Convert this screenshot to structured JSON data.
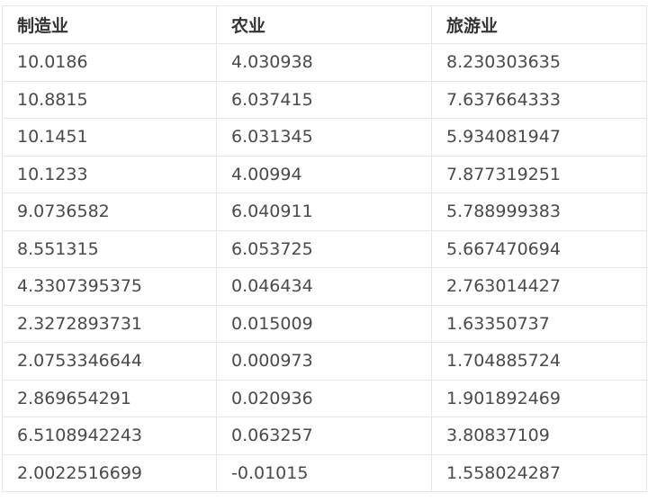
{
  "table": {
    "headers": [
      "制造业",
      "农业",
      "旅游业"
    ],
    "rows": [
      [
        "10.0186",
        "4.030938",
        "8.230303635"
      ],
      [
        "10.8815",
        "6.037415",
        "7.637664333"
      ],
      [
        "10.1451",
        "6.031345",
        "5.934081947"
      ],
      [
        "10.1233",
        "4.00994",
        "7.877319251"
      ],
      [
        "9.0736582",
        "6.040911",
        "5.788999383"
      ],
      [
        "8.551315",
        "6.053725",
        "5.667470694"
      ],
      [
        "4.3307395375",
        "0.046434",
        "2.763014427"
      ],
      [
        "2.3272893731",
        "0.015009",
        "1.63350737"
      ],
      [
        "2.0753346644",
        "0.000973",
        "1.704885724"
      ],
      [
        "2.869654291",
        "0.020936",
        "1.901892469"
      ],
      [
        "6.5108942243",
        "0.063257",
        "3.80837109"
      ],
      [
        "2.0022516699",
        "-0.01015",
        "1.558024287"
      ]
    ]
  }
}
